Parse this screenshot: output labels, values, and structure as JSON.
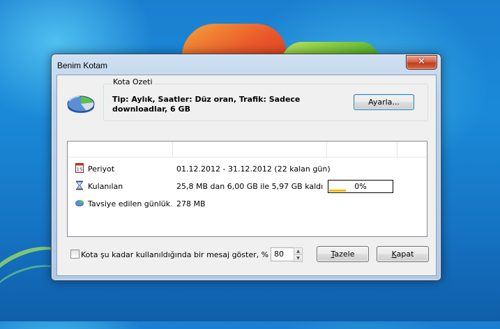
{
  "window": {
    "title": "Benim Kotam",
    "close_glyph": "✕"
  },
  "summary": {
    "group_label": "Kota Ozeti",
    "tip": "Tip: Aylık, Saatler: Düz oran, Trafik: Sadece downloadlar, 6 GB",
    "setup_button": "Ayarla..."
  },
  "list": {
    "rows": [
      {
        "icon": "calendar-icon",
        "label": "Periyot",
        "value": "01.12.2012 - 31.12.2012 (22 kalan gün)"
      },
      {
        "icon": "hourglass-icon",
        "label": "Kulanılan",
        "value": "25,8 MB dan 6,00 GB ile 5,97 GB kaldı"
      },
      {
        "icon": "pie-chart-icon",
        "label": "Tavsiye edilen günlük...",
        "value": "278 MB"
      }
    ],
    "progress": {
      "label": "0%",
      "fraction": 0.004
    }
  },
  "footer": {
    "checkbox_label": "Kota şu kadar kullanıldığında bir mesaj göster, %",
    "checkbox_checked": false,
    "threshold_value": "80",
    "refresh_button": "Tazele",
    "close_button": "Kapat"
  },
  "colors": {
    "progress_fill": "#f0b800",
    "close_button": "#c23d20"
  }
}
